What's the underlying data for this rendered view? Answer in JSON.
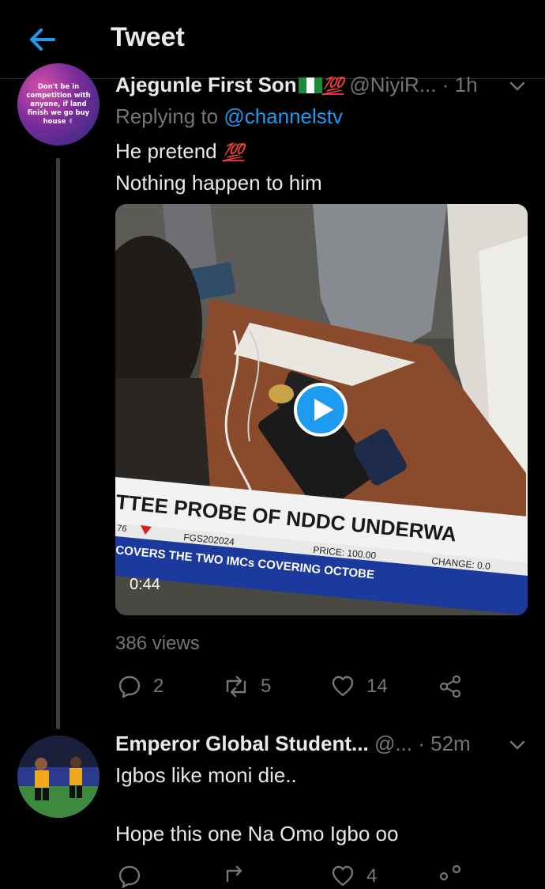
{
  "header": {
    "title": "Tweet",
    "back_icon": "arrow-left-icon",
    "accent": "#1d9bf0"
  },
  "tweet1": {
    "avatar_text": "Don't be in competition with anyone, if land finish we go buy house ✌",
    "display_name": "Ajegunle First Son",
    "emoji": "💯",
    "handle": "@NiyiR...",
    "time": "· 1h",
    "replying_prefix": "Replying to",
    "replying_handle": "@channelstv",
    "line1": "He pretend",
    "line1_emoji": "💯",
    "line2": "Nothing happen to him",
    "video": {
      "ticker_headline": "TTEE PROBE OF NDDC UNDERWA",
      "ticker_left": "76",
      "ticker_code": "FGS202024",
      "ticker_price": "PRICE: 100.00",
      "ticker_change": "CHANGE: 0.0",
      "ticker_bottom": "COVERS THE TWO IMCs COVERING OCTOBE",
      "duration": "0:44"
    },
    "views": "386 views",
    "actions": {
      "replies": "2",
      "retweets": "5",
      "likes": "14"
    }
  },
  "tweet2": {
    "display_name": "Emperor Global Student...",
    "handle": "@...",
    "time": "· 52m",
    "line1": "Igbos like moni die..",
    "line2": "Hope this one Na Omo Igbo oo",
    "actions": {
      "likes": "4"
    }
  }
}
